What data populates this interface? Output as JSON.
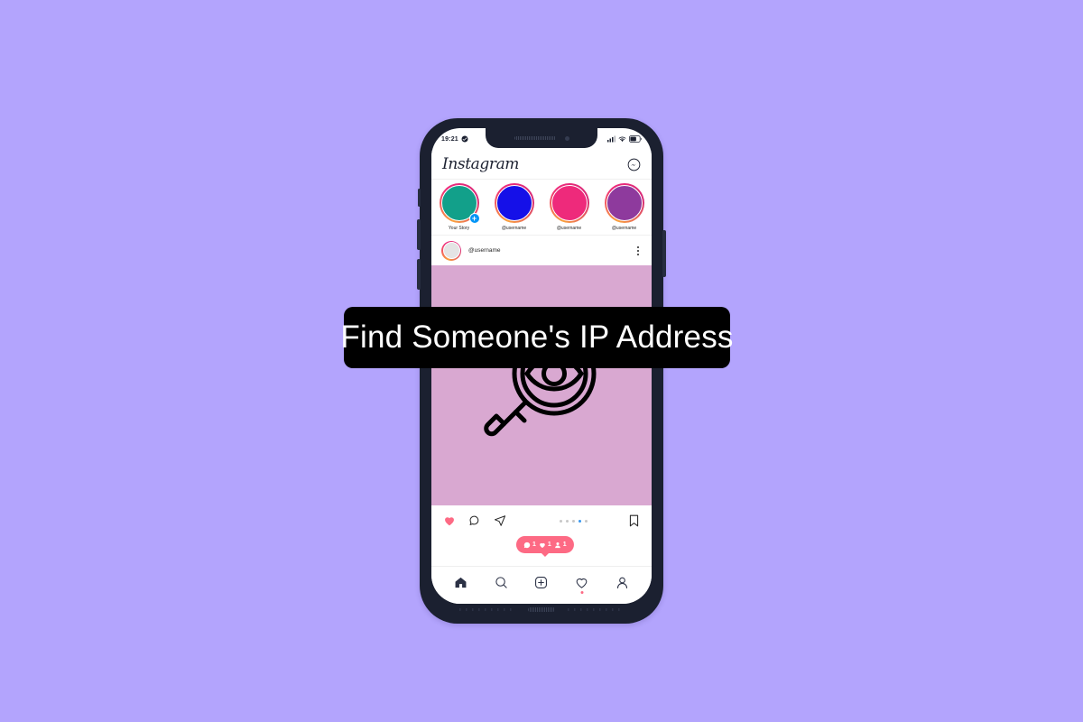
{
  "banner": {
    "title": "Find Someone's IP Address",
    "background_color": "#000000",
    "text_color": "#ffffff"
  },
  "page": {
    "background_color": "#b3a4fd"
  },
  "phone": {
    "frame_color": "#1b2030",
    "screen_color": "#ffffff",
    "buttons": [
      {
        "name": "silent-switch"
      },
      {
        "name": "volume-up"
      },
      {
        "name": "volume-down"
      },
      {
        "name": "power"
      }
    ]
  },
  "status_bar": {
    "time": "19:21",
    "icons": [
      "message-icon",
      "signal-icon",
      "wifi-icon",
      "battery-icon"
    ]
  },
  "app_header": {
    "wordmark": "Instagram",
    "messenger_icon": "messenger-icon"
  },
  "stories": [
    {
      "label": "Your Story",
      "avatar_color": "#12a08a",
      "has_add_badge": true,
      "add_badge_label": "+"
    },
    {
      "label": "@username",
      "avatar_color": "#1510e8",
      "has_add_badge": false,
      "add_badge_label": ""
    },
    {
      "label": "@username",
      "avatar_color": "#ee2a7b",
      "has_add_badge": false,
      "add_badge_label": ""
    },
    {
      "label": "@username",
      "avatar_color": "#8e3a9d",
      "has_add_badge": false,
      "add_badge_label": ""
    }
  ],
  "post": {
    "username": "@username",
    "image_background": "#d9a8d1",
    "illustration": "magnifier-eye-icon",
    "menu_icon": "more-options-icon"
  },
  "action_bar": {
    "like_icon": "heart-filled-icon",
    "comment_icon": "comment-icon",
    "share_icon": "share-icon",
    "bookmark_icon": "bookmark-icon",
    "page_dots": {
      "count": 5,
      "active_index": 3
    }
  },
  "notification_badge": {
    "background_color": "#fd6a84",
    "items": [
      {
        "icon": "comment-icon",
        "count": "1"
      },
      {
        "icon": "heart-icon",
        "count": "1"
      },
      {
        "icon": "person-icon",
        "count": "1"
      }
    ]
  },
  "bottom_nav": [
    {
      "name": "home",
      "icon": "home-icon",
      "active": true
    },
    {
      "name": "search",
      "icon": "search-icon",
      "active": false
    },
    {
      "name": "create",
      "icon": "plus-box-icon",
      "active": false
    },
    {
      "name": "activity",
      "icon": "heart-icon",
      "active": false,
      "has_dot": true
    },
    {
      "name": "profile",
      "icon": "person-icon",
      "active": false
    }
  ]
}
